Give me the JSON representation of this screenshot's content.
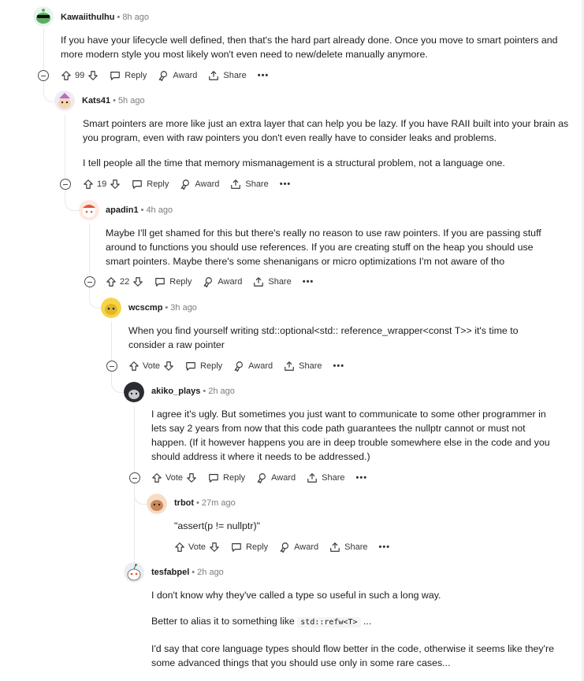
{
  "comments": [
    {
      "author": "Kawaiithulhu",
      "time": "8h ago",
      "votes": "99",
      "paragraphs": [
        "If you have your lifecycle well defined, then that's the hard part already done. Once you move to smart pointers and more modern style you most likely won't even need to new/delete manually anymore."
      ]
    },
    {
      "author": "Kats41",
      "time": "5h ago",
      "votes": "19",
      "paragraphs": [
        "Smart pointers are more like just an extra layer that can help you be lazy. If you have RAII built into your brain as you program, even with raw pointers you don't even really have to consider leaks and problems.",
        "I tell people all the time that memory mismanagement is a structural problem, not a language one."
      ]
    },
    {
      "author": "apadin1",
      "time": "4h ago",
      "votes": "22",
      "paragraphs": [
        "Maybe I'll get shamed for this but there's really no reason to use raw pointers. If you are passing stuff around to functions you should use references. If you are creating stuff on the heap you should use smart pointers. Maybe there's some shenanigans or micro optimizations I'm not aware of tho"
      ]
    },
    {
      "author": "wcscmp",
      "time": "3h ago",
      "votes": "Vote",
      "paragraphs": [
        "When you find yourself writing std::optional<std:: reference_wrapper<const T>> it's time to consider a raw pointer"
      ]
    },
    {
      "author": "akiko_plays",
      "time": "2h ago",
      "votes": "Vote",
      "paragraphs": [
        "I agree it's ugly. But sometimes you just want to communicate to some other programmer in lets say 2 years from now that this code path guarantees the nullptr cannot or must not happen. (If it however happens you are in deep trouble somewhere else in the code and you should address it where it needs to be addressed.)"
      ]
    },
    {
      "author": "trbot",
      "time": "27m ago",
      "votes": "Vote",
      "paragraphs": [
        "\"assert(p != nullptr)\""
      ]
    },
    {
      "author": "tesfabpel",
      "time": "2h ago",
      "p1": "I don't know why they've called a type so useful in such a long way.",
      "p2_pre": "Better to alias it to something like",
      "p2_code": "std::refw<T>",
      "p2_post": "...",
      "p3": "I'd say that core language types should flow better in the code, otherwise it seems like they're some advanced things that you should use only in some rare cases..."
    }
  ],
  "actions": {
    "reply": "Reply",
    "award": "Award",
    "share": "Share",
    "more": "•••"
  },
  "separator": "•",
  "colors": {
    "text": "#1c1c1c",
    "meta": "#7c7c7c",
    "thread": "#e5e9eb"
  }
}
